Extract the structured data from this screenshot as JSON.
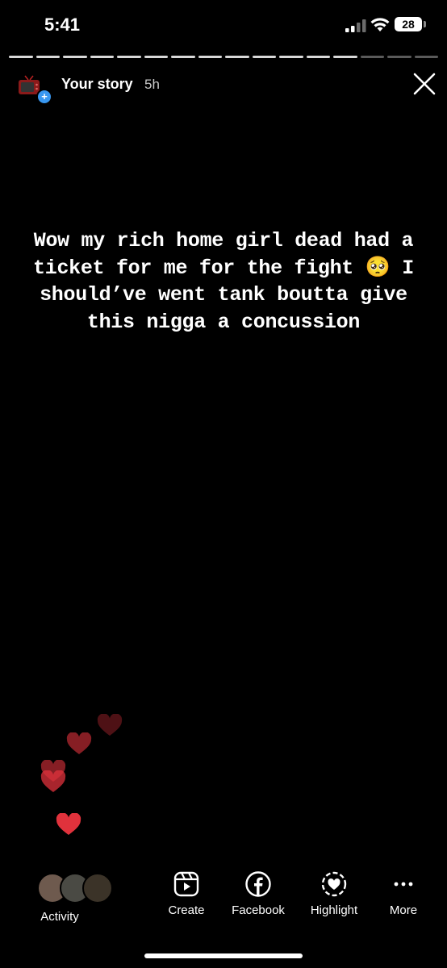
{
  "status_bar": {
    "time": "5:41",
    "battery": "28",
    "icons": [
      "cellular-signal-icon",
      "wifi-icon",
      "battery-icon"
    ]
  },
  "progress": {
    "total_segments": 16,
    "viewed_segments": 13
  },
  "story_header": {
    "label": "Your story",
    "age": "5h",
    "avatar_icon": "tv-avatar-icon",
    "close_icon": "close-icon"
  },
  "story": {
    "text_before_emoji": "Wow my rich home girl dead had a ticket for me for the fight",
    "emoji": "🥺",
    "text_after_emoji": "I should’ve went tank boutta give this nigga a concussion"
  },
  "reactions": {
    "icon": "heart-icon",
    "color": "#e0323c",
    "count": 6
  },
  "bottom_bar": {
    "activity": "Activity",
    "create": "Create",
    "facebook": "Facebook",
    "highlight": "Highlight",
    "more": "More"
  },
  "colors": {
    "background": "#000000",
    "accent": "#3897f0",
    "heart": "#e0323c"
  }
}
